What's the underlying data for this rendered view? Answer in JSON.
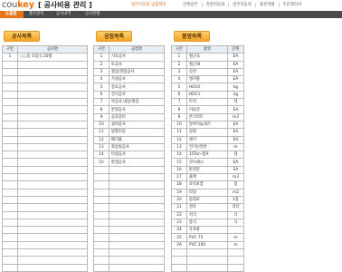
{
  "app": {
    "logo_main": "cou",
    "logo_key": "key",
    "title": "[ 공사비용 관리 ]",
    "promo": "업무자동화 맞춤제작"
  },
  "top_menu": [
    "전체업무",
    "경영자동화",
    "업무자동화",
    "표준엑셀",
    "주문제작서"
  ],
  "nav": {
    "tabs": [
      {
        "label": "도움말",
        "active": true
      },
      {
        "label": "품목관리",
        "active": false
      },
      {
        "label": "공사내역",
        "active": false
      },
      {
        "label": "공사현황",
        "active": false
      }
    ]
  },
  "sections": {
    "construction_list": "공사목록",
    "process_list": "공정목록",
    "item_list": "품명목록"
  },
  "construction_table": {
    "headers": [
      "구분",
      "공사명"
    ],
    "rows": [
      [
        "1",
        "○○동 조립식 20평"
      ]
    ]
  },
  "process_table": {
    "headers": [
      "구분",
      "공정명"
    ],
    "rows": [
      [
        "1",
        "기초공사"
      ],
      [
        "2",
        "토공사"
      ],
      [
        "3",
        "철골/경량공사"
      ],
      [
        "4",
        "가설공사"
      ],
      [
        "5",
        "창호공사"
      ],
      [
        "6",
        "전기공사"
      ],
      [
        "7",
        "목공사 내장/외장"
      ],
      [
        "8",
        "판넬공사"
      ],
      [
        "9",
        "공조장비"
      ],
      [
        "10",
        "설비공사"
      ],
      [
        "11",
        "방통미장"
      ],
      [
        "12",
        "폐기물"
      ],
      [
        "13",
        "화장실공사"
      ],
      [
        "14",
        "타일공사"
      ],
      [
        "15",
        "판넬공사"
      ]
    ]
  },
  "item_table": {
    "headers": [
      "구분",
      "품명",
      "단위"
    ],
    "rows": [
      [
        "1",
        "철근/1",
        "EA"
      ],
      [
        "2",
        "철근/8",
        "EA"
      ],
      [
        "3",
        "강관",
        "EA"
      ],
      [
        "4",
        "앵커볼",
        "EA"
      ],
      [
        "5",
        "HD10",
        "kg"
      ],
      [
        "6",
        "HD13",
        "kg"
      ],
      [
        "7",
        "트럭",
        "대"
      ],
      [
        "8",
        "이동관",
        "EA"
      ],
      [
        "9",
        "콘크리트",
        "m3"
      ],
      [
        "10",
        "알루미늄게기",
        "EA"
      ],
      [
        "11",
        "장화",
        "EA"
      ],
      [
        "12",
        "레기",
        "EA"
      ],
      [
        "13",
        "전기난연관",
        "m"
      ],
      [
        "14",
        "15Ton 펌프",
        "대"
      ],
      [
        "15",
        "하이새시",
        "EA"
      ],
      [
        "16",
        "판관문",
        "EA"
      ],
      [
        "17",
        "플랫",
        "m3"
      ],
      [
        "18",
        "조적포함",
        "일"
      ],
      [
        "19",
        "타일",
        "m2"
      ],
      [
        "20",
        "동청로",
        "1종"
      ],
      [
        "21",
        "경유",
        "리터"
      ],
      [
        "22",
        "석식",
        "식"
      ],
      [
        "23",
        "중식",
        "식"
      ],
      [
        "24",
        "유포롱",
        ""
      ],
      [
        "25",
        "PVC 75",
        "m"
      ],
      [
        "26",
        "PVC 100",
        "m"
      ]
    ]
  },
  "colors": {
    "accent": "#e8731a",
    "nav_bg": "#4a4a4a",
    "section_bg": "#f5a623",
    "header_bg": "#e9eef3"
  }
}
